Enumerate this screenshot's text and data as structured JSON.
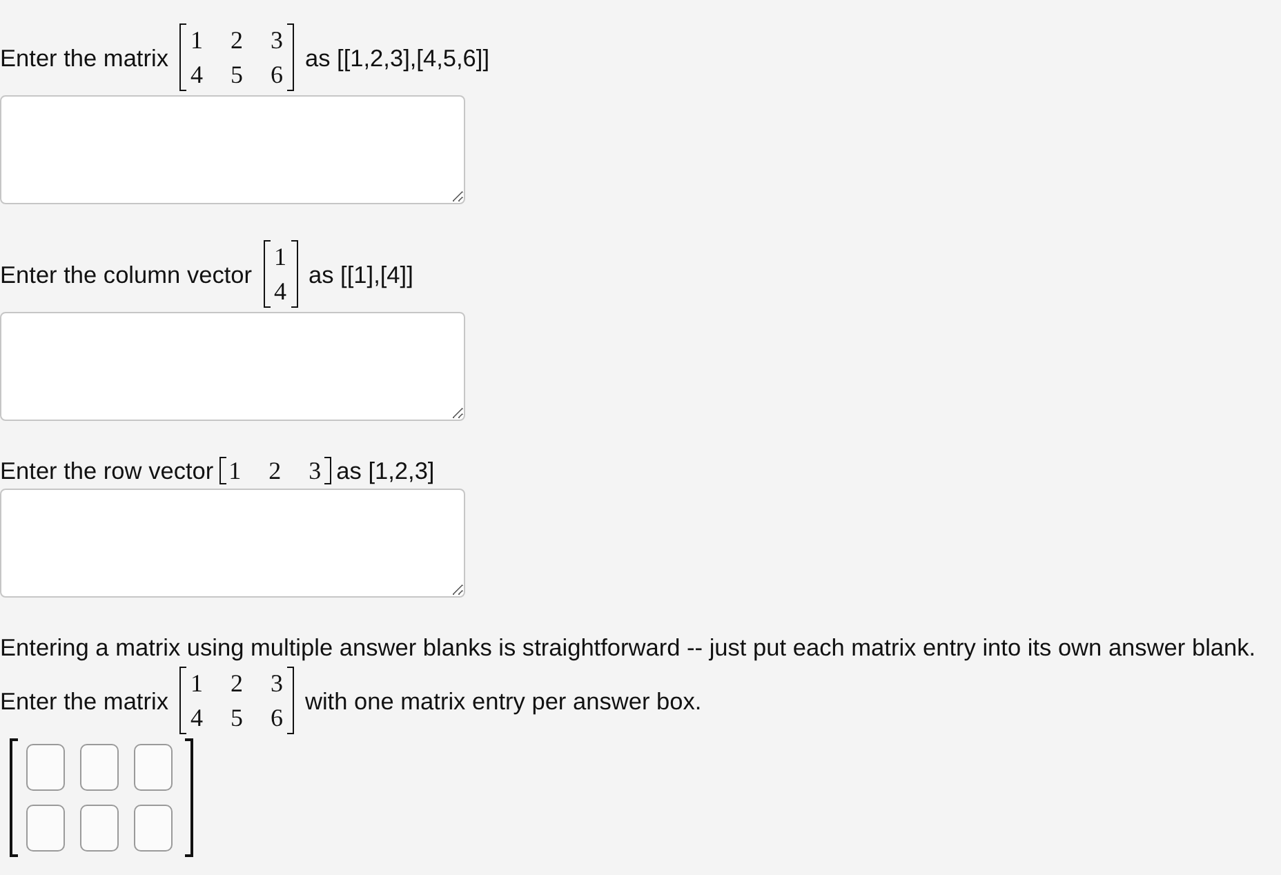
{
  "items": [
    {
      "kind": "question",
      "prompt": "Enter the matrix",
      "matrix": [
        [
          "1",
          "2",
          "3"
        ],
        [
          "4",
          "5",
          "6"
        ]
      ],
      "hint": "as [[1,2,3],[4,5,6]]",
      "answer": {
        "kind": "textarea"
      }
    },
    {
      "kind": "question",
      "prompt": "Enter the column vector",
      "matrix": [
        [
          "1"
        ],
        [
          "4"
        ]
      ],
      "hint": "as [[1],[4]]",
      "answer": {
        "kind": "textarea"
      }
    },
    {
      "kind": "question",
      "prompt": "Enter the row vector",
      "matrix": [
        [
          "1",
          "2",
          "3"
        ]
      ],
      "hint": "as [1,2,3]",
      "answer": {
        "kind": "textarea"
      }
    },
    {
      "kind": "paragraph",
      "text": "Entering a matrix using multiple answer blanks is straightforward -- just put each matrix entry into its own answer blank."
    },
    {
      "kind": "question",
      "prompt": "Enter the matrix",
      "matrix": [
        [
          "1",
          "2",
          "3"
        ],
        [
          "4",
          "5",
          "6"
        ]
      ],
      "hint": "with one matrix entry per answer box.",
      "answer": {
        "kind": "grid",
        "cells": [
          [
            {
              "kind": "blank"
            },
            {
              "kind": "blank"
            },
            {
              "kind": "blank"
            }
          ],
          [
            {
              "kind": "blank"
            },
            {
              "kind": "blank"
            },
            {
              "kind": "blank"
            }
          ]
        ]
      }
    }
  ]
}
